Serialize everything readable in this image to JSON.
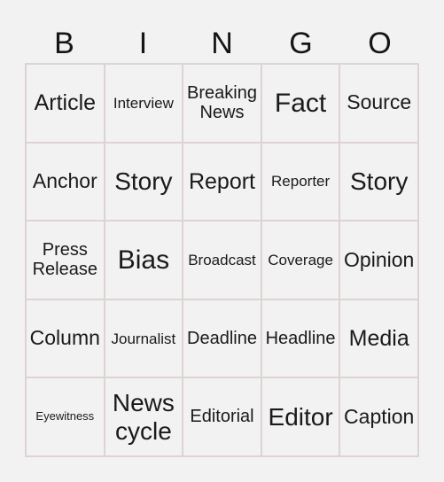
{
  "card": {
    "title_letters": [
      "B",
      "I",
      "N",
      "G",
      "O"
    ],
    "colors": {
      "page_background": "#f2f2f2",
      "cell_background": "#f2f2f2",
      "grid_border": "#ded3d3",
      "text": "#1a1a1a"
    },
    "columns": 5,
    "rows": 5,
    "cells": [
      {
        "text": "Article",
        "size": "fs-2xl"
      },
      {
        "text": "Interview",
        "size": "fs-md"
      },
      {
        "text": "Breaking News",
        "size": "fs-lg"
      },
      {
        "text": "Fact",
        "size": "fs-4xl"
      },
      {
        "text": "Source",
        "size": "fs-xl"
      },
      {
        "text": "Anchor",
        "size": "fs-xl"
      },
      {
        "text": "Story",
        "size": "fs-3xl"
      },
      {
        "text": "Report",
        "size": "fs-2xl"
      },
      {
        "text": "Reporter",
        "size": "fs-md"
      },
      {
        "text": "Story",
        "size": "fs-3xl"
      },
      {
        "text": "Press Release",
        "size": "fs-lg"
      },
      {
        "text": "Bias",
        "size": "fs-4xl"
      },
      {
        "text": "Broadcast",
        "size": "fs-md"
      },
      {
        "text": "Coverage",
        "size": "fs-md"
      },
      {
        "text": "Opinion",
        "size": "fs-xl"
      },
      {
        "text": "Column",
        "size": "fs-xl"
      },
      {
        "text": "Journalist",
        "size": "fs-md"
      },
      {
        "text": "Deadline",
        "size": "fs-lg"
      },
      {
        "text": "Headline",
        "size": "fs-lg"
      },
      {
        "text": "Media",
        "size": "fs-2xl"
      },
      {
        "text": "Eyewitness",
        "size": "fs-xs"
      },
      {
        "text": "News cycle",
        "size": "fs-3xl"
      },
      {
        "text": "Editorial",
        "size": "fs-lg"
      },
      {
        "text": "Editor",
        "size": "fs-3xl"
      },
      {
        "text": "Caption",
        "size": "fs-xl"
      }
    ]
  }
}
